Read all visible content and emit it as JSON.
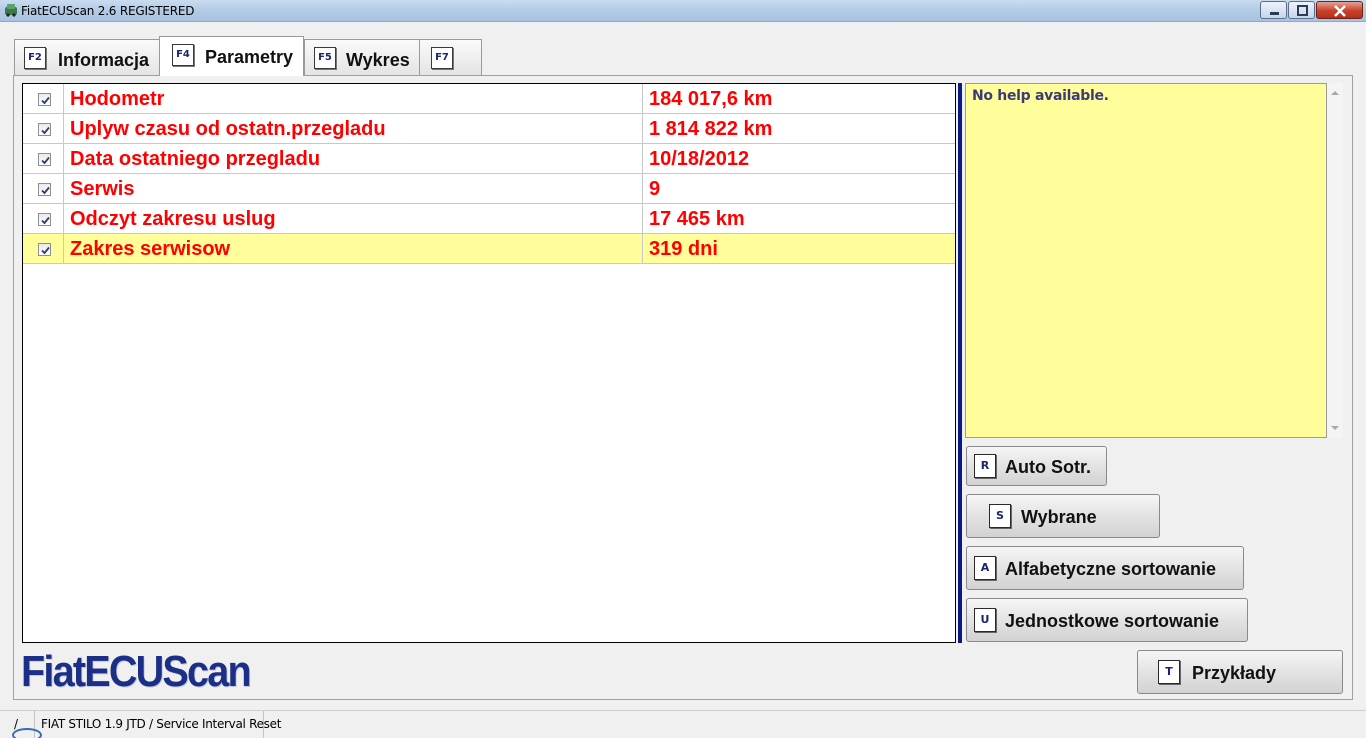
{
  "window": {
    "title": "FiatECUScan 2.6 REGISTERED"
  },
  "tabs": [
    {
      "key": "F2",
      "label": "Informacja"
    },
    {
      "key": "F4",
      "label": "Parametry"
    },
    {
      "key": "F5",
      "label": "Wykres"
    },
    {
      "key": "F7",
      "label": ""
    }
  ],
  "parameters": [
    {
      "name": "Hodometr",
      "value": "184 017,6 km",
      "checked": true
    },
    {
      "name": "Uplyw czasu od ostatn.przegladu",
      "value": "1 814 822 km",
      "checked": true
    },
    {
      "name": "Data ostatniego przegladu",
      "value": "10/18/2012",
      "checked": true
    },
    {
      "name": "Serwis",
      "value": "9",
      "checked": true
    },
    {
      "name": "Odczyt zakresu uslug",
      "value": "17 465 km",
      "checked": true
    },
    {
      "name": "Zakres serwisow",
      "value": "319 dni",
      "checked": true,
      "selected": true
    }
  ],
  "help": {
    "text": "No help available."
  },
  "buttons": {
    "auto_sort": {
      "key": "R",
      "label": "Auto Sotr."
    },
    "selected": {
      "key": "S",
      "label": "Wybrane"
    },
    "alpha_sort": {
      "key": "A",
      "label": "Alfabetyczne sortowanie"
    },
    "unit_sort": {
      "key": "U",
      "label": "Jednostkowe sortowanie"
    },
    "examples": {
      "key": "T",
      "label": "Przykłady"
    }
  },
  "logo": {
    "text": "FiatECUScan"
  },
  "status": {
    "segment1": "/",
    "segment2": "FIAT STILO 1.9 JTD / Service Interval Reset"
  },
  "colors": {
    "value_text": "#ff0000",
    "selected_row": "#fffe9a",
    "help_background": "#fffe9a",
    "logo": "#1c2f86",
    "separator": "#0a1a82"
  }
}
